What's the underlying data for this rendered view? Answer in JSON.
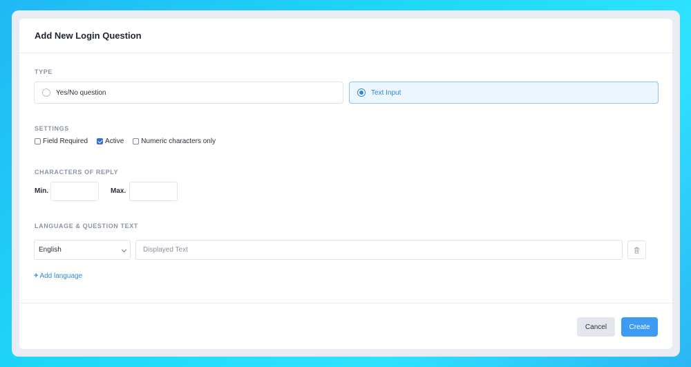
{
  "modal": {
    "title": "Add New Login Question"
  },
  "type": {
    "label": "TYPE",
    "options": [
      {
        "label": "Yes/No question",
        "selected": false
      },
      {
        "label": "Text Input",
        "selected": true
      }
    ]
  },
  "settings": {
    "label": "SETTINGS",
    "options": [
      {
        "label": "Field Required",
        "checked": false
      },
      {
        "label": "Active",
        "checked": true
      },
      {
        "label": "Numeric characters only",
        "checked": false
      }
    ]
  },
  "characters": {
    "label": "CHARACTERS OF REPLY",
    "min_label": "Min.",
    "max_label": "Max.",
    "min_value": "",
    "max_value": ""
  },
  "language": {
    "label": "LANGUAGE & QUESTION TEXT",
    "selected": "English",
    "text_placeholder": "Displayed Text",
    "add_label": "Add language",
    "icons": {
      "delete": "trash-icon",
      "add": "plus-icon",
      "dropdown": "chevron-down-icon"
    }
  },
  "footer": {
    "cancel_label": "Cancel",
    "create_label": "Create"
  },
  "colors": {
    "accent": "#3d9cf1",
    "link": "#2f88d6",
    "selected_bg": "#eef6fd"
  }
}
